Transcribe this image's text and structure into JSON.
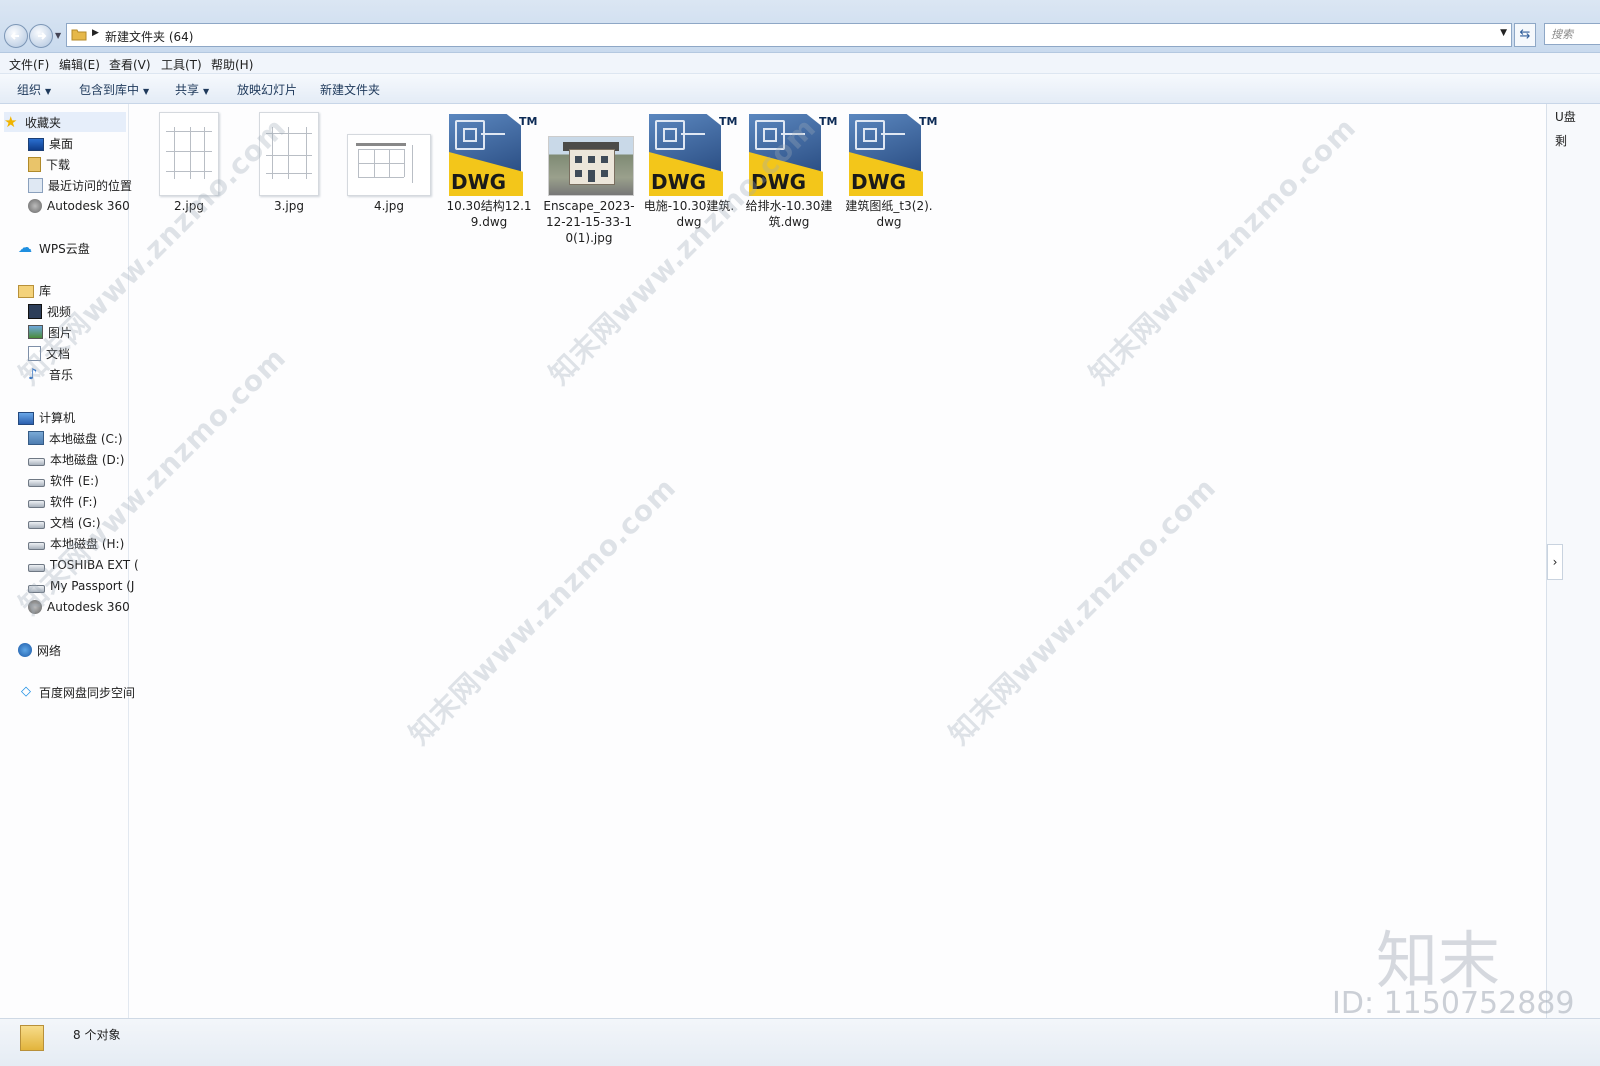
{
  "address": {
    "path": "新建文件夹 (64)",
    "search_placeholder": "搜索"
  },
  "menu": [
    "文件(F)",
    "编辑(E)",
    "查看(V)",
    "工具(T)",
    "帮助(H)"
  ],
  "toolbar": [
    "组织",
    "包含到库中",
    "共享",
    "放映幻灯片",
    "新建文件夹"
  ],
  "sidebar": {
    "favorites": {
      "label": "收藏夹",
      "items": [
        "桌面",
        "下载",
        "最近访问的位置",
        "Autodesk 360"
      ]
    },
    "wps": "WPS云盘",
    "library": {
      "label": "库",
      "items": [
        "视频",
        "图片",
        "文档",
        "音乐"
      ]
    },
    "computer": {
      "label": "计算机",
      "items": [
        "本地磁盘 (C:)",
        "本地磁盘 (D:)",
        "软件 (E:)",
        "软件 (F:)",
        "文档 (G:)",
        "本地磁盘 (H:)",
        "TOSHIBA EXT (",
        "My Passport (J",
        "Autodesk 360"
      ]
    },
    "network": "网络",
    "baidu": "百度网盘同步空间"
  },
  "files": [
    {
      "name": "2.jpg",
      "type": "drawing"
    },
    {
      "name": "3.jpg",
      "type": "drawing"
    },
    {
      "name": "4.jpg",
      "type": "elevation"
    },
    {
      "name": "10.30结构12.19.dwg",
      "type": "dwg"
    },
    {
      "name": "Enscape_2023-12-21-15-33-10(1).jpg",
      "type": "photo"
    },
    {
      "name": "电施-10.30建筑.dwg",
      "type": "dwg"
    },
    {
      "name": "给排水-10.30建筑.dwg",
      "type": "dwg"
    },
    {
      "name": "建筑图纸_t3(2).dwg",
      "type": "dwg"
    }
  ],
  "dwg_badge": "DWG",
  "dwg_tm": "TM",
  "right_panel": [
    "U盘",
    "剩"
  ],
  "status": "8 个对象",
  "watermark": {
    "text": "知末网www.znzmo.com",
    "brand": "知末",
    "id": "ID: 1150752889"
  },
  "colors": {
    "dwg_blue": "#1e3f74",
    "dwg_yellow": "#f3c61a",
    "selection": "#e6eefa"
  }
}
